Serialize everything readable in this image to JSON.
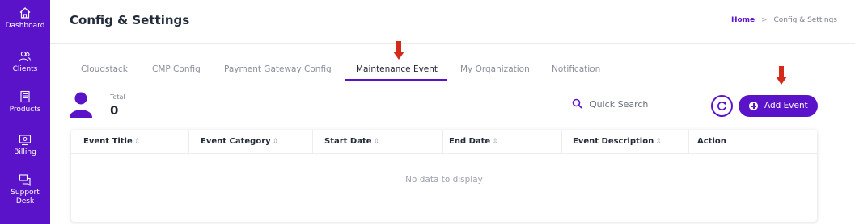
{
  "sidebar": {
    "items": [
      {
        "label": "Dashboard",
        "icon": "home-icon"
      },
      {
        "label": "Clients",
        "icon": "users-icon"
      },
      {
        "label": "Products",
        "icon": "server-icon"
      },
      {
        "label": "Billing",
        "icon": "billing-icon"
      },
      {
        "label": "Support Desk",
        "icon": "chat-icon"
      }
    ]
  },
  "header": {
    "title": "Config & Settings",
    "breadcrumb": {
      "home": "Home",
      "separator": ">",
      "current": "Config & Settings"
    }
  },
  "tabs": [
    {
      "label": "Cloudstack",
      "active": false
    },
    {
      "label": "CMP Config",
      "active": false
    },
    {
      "label": "Payment Gateway Config",
      "active": false
    },
    {
      "label": "Maintenance Event",
      "active": true
    },
    {
      "label": "My Organization",
      "active": false
    },
    {
      "label": "Notification",
      "active": false
    }
  ],
  "summary": {
    "total_label": "Total",
    "total_value": "0"
  },
  "search": {
    "placeholder": "Quick Search",
    "value": ""
  },
  "buttons": {
    "refresh_icon": "refresh-icon",
    "add_label": "Add Event"
  },
  "table": {
    "columns": [
      "Event Title",
      "Event Category",
      "Start Date",
      "End Date",
      "Event Description",
      "Action"
    ],
    "sort_glyph": "⇕",
    "empty_text": "No data to display"
  },
  "colors": {
    "accent": "#5a13c9",
    "annotation_arrow": "#d42a1a"
  }
}
